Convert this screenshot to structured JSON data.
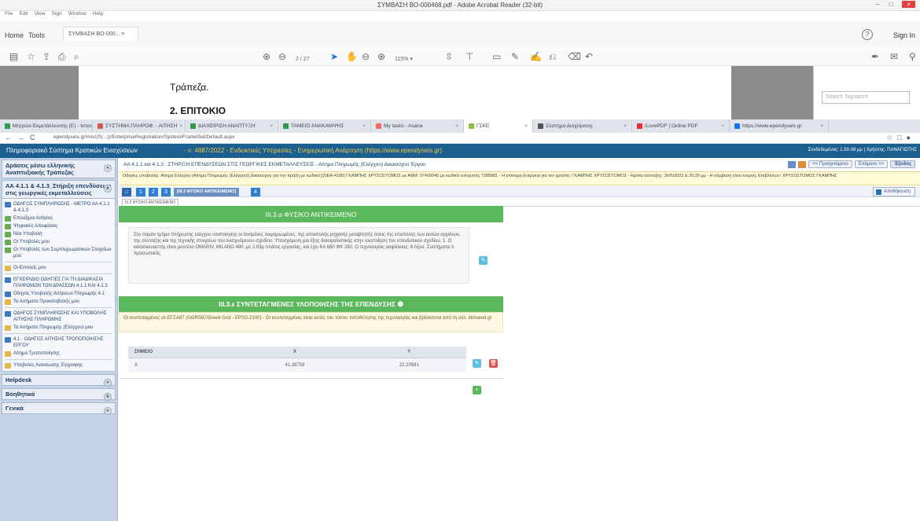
{
  "acrobat": {
    "title": "ΣΥΜΒΑΣΗ ΒΟ-000468.pdf - Adobe Acrobat Reader (32-bit)",
    "menu": [
      "File",
      "Edit",
      "View",
      "Sign",
      "Window",
      "Help"
    ],
    "home_tab": "Home",
    "tools_tab": "Tools",
    "doc_tab": "ΣΥΜΒΑΣΗ ΒΟ-000... ×",
    "sign_in": "Sign In",
    "page_num": "2 / 27",
    "zoom": "115% ▾",
    "sig_placeholder": "Search Signature",
    "doc_line1": "Τράπεζα.",
    "doc_line2": "2.  ΕΠΙΤΟΚΙΟ"
  },
  "browser": {
    "tabs": [
      {
        "label": "Μητρώο Εκμετάλλευσης (Ε) - Ιστοσελίδα",
        "color": "#2f9b4a"
      },
      {
        "label": "ΣΥΣΤΗΜΑ ΠΛΗΡΟΦ. - ΑΙΤΗΣΗ",
        "color": "#d9534f"
      },
      {
        "label": "ΔΙΑΧΕΙΡΙΣΗ ΑΝΑΠΤΥΞΗ",
        "color": "#2f9b4a"
      },
      {
        "label": "ΤΑΜΕΙΟ ΑΝΑΚΑΜΨΗΣ",
        "color": "#2f9b4a"
      },
      {
        "label": "My tasks - Asana",
        "color": "#f06a6a"
      },
      {
        "label": "ΓΣΚΕ",
        "color": "#8bbf3f"
      },
      {
        "label": "Σύστημα Διαχείρισης",
        "color": "#555555"
      },
      {
        "label": "iLovePDF | Online PDF",
        "color": "#e5322d"
      },
      {
        "label": "https://www.ependyseis.gr",
        "color": "#1a73e8"
      }
    ],
    "url": "ependyseis.gr/mis/(S(...))/EnterpriseRegistration/System/FrameSet/Default.aspx"
  },
  "header": {
    "system": "Πληροφοριακό Σύστημα Κρατικών Ενισχύσεων",
    "regulation": "- ν. 4887/2022 - Ενδεικτικές Υπηρεσίες - Ενημερωτική Ανάρτηση (https://www.ependyseis.gr)",
    "user": "Συνδεδεμένος: 1.50.08 μμ | Χρήστης: ΠΑΝΑΓΙΩΤΗΣ"
  },
  "sidebar": {
    "top": {
      "title": "Δράσεις μέσω ελληνικής Αναπτυξιακής Τράπεζας",
      "toggle": "«"
    },
    "active": {
      "title": "ΑΑ 4.1.1 & 4.1.3_Στήριξη επενδύσεων στις γεωργικές εκμεταλλεύσεις",
      "toggle": "∧"
    },
    "items": [
      {
        "label": "ΟΔΗΓΟΣ ΣΥΜΠΛΗΡΩΣΗΣ - ΜΕΤΡΟ ΑΑ 4.1.1 & 4.1.3",
        "icon": "b",
        "sep": false
      },
      {
        "label": "Επιλέξιμοι Αιτήσεις",
        "icon": "g",
        "sep": false
      },
      {
        "label": "Ψηφιακές Αποφάσεις",
        "icon": "g",
        "sep": false
      },
      {
        "label": "Νέα Υποβολή",
        "icon": "g",
        "sep": false
      },
      {
        "label": "Οι Υποβολές μου",
        "icon": "g",
        "sep": false
      },
      {
        "label": "Οι Υποβολές των Συμπληρωματικών Στοιχείων μου",
        "icon": "g",
        "sep": false
      },
      {
        "label": "Οι Εντολείς μου",
        "icon": "y",
        "sep": true
      },
      {
        "label": "ΕΓΧΕΙΡΙΔΙΟ ΟΔΗΓΙΕΣ ΓΙΑ ΤΗ ΔΙΑΔΙΚΑΣΙΑ ΠΛΗΡΩΜΩΝ ΤΩΝ ΔΡΑΣΕΩΝ 4.1.1 ΚΑΙ 4.1.3",
        "icon": "b",
        "sep": true
      },
      {
        "label": "Οδηγός Υποβολής Αιτήσεων Πληρωμής 4.1",
        "icon": "b",
        "sep": false
      },
      {
        "label": "Τα Αιτήματα Προκαταβολής μου",
        "icon": "y",
        "sep": false
      },
      {
        "label": "ΟΔΗΓΟΣ ΣΥΜΠΛΗΡΩΣΗΣ ΚΑΙ ΥΠΟΒΟΛΗΣ ΑΙΤΗΣΗΣ ΠΛΗΡΩΜΗΣ",
        "icon": "b",
        "sep": true
      },
      {
        "label": "Τα Αιτήματα Πληρωμής (Ελέγχου) μου",
        "icon": "y",
        "sep": false
      },
      {
        "label": "4.1 - ΟΔΗΓΟΣ ΑΙΤΗΣΗΣ ΤΡΟΠΟΠΟΙΗΣΗΣ ΕΡΓΟΥ",
        "icon": "b",
        "sep": true
      },
      {
        "label": "Αίτημα Τροποποίησης",
        "icon": "y",
        "sep": false
      },
      {
        "label": "Υποβολές Ανανέωσης Έγγραφης",
        "icon": "y",
        "sep": true
      }
    ],
    "bottom": [
      {
        "title": "Helpdesk",
        "toggle": "»"
      },
      {
        "title": "Βοηθητικά",
        "toggle": "∨"
      },
      {
        "title": "Γενικά",
        "toggle": "»"
      }
    ]
  },
  "main": {
    "path": "ΑΑ 4.1.1 και 4.1.3 : ΣΤΗΡΙΞΗ ΕΠΕΝΔΥΣΕΩΝ ΣΤΙΣ ΓΕΩΡΓΙΚΕΣ ΕΚΜΕΤΑΛΛΕΥΣΕΙΣ - Αίτημα Πληρωμής (Ελέγχου) Δικαιούχου Έργου",
    "prev": "<< Προηγούμενο",
    "next": "Επόμενο >>",
    "exit": "Έξοδος",
    "notice": "Οδηγίες υποβολής: Αίτημα Ελέγχου (Αίτημα Πληρωμής (Ελέγχου)) Δικαιούχου για την πράξη με κωδικό [20EA-4185] ΓΚΑΜΠΗΣ ΧΡΥΣΟΣΤΟΜΟΣ με ΑΦΜ: 07400045 με κωδικό ενίσχυσης 7285881 - Η επίσημη Ενέργεια για τον χρήστη: ΓΚΑΜΠΗΣ ΧΡΥΣΟΣΤΟΜΟΣ - Ημ/νία σύνταξης: 30/5/2023 & 20:29 μμ - Η σύμβαση είναι ενεργή, Επιβλέπων: ΧΡΥΣΟΣΤΟΜΟΣ ΓΚΑΜΠΗΣ",
    "steps": [
      "1",
      "2",
      "3"
    ],
    "step_label": "[III.3 ΦΥΣΙΚΟ ΑΝΤΙΚΕΙΜΕΝΟ]",
    "step_next": "4",
    "save": "Αποθήκευση",
    "subtab": "III.3 ΦΥΣΙΚΟ ΑΝΤΙΚΕΙΜΕΝΟ",
    "panel1_title": "III.3.α ΦΥΣΙΚΟ ΑΝΤΙΚΕΙΜΕΝΟ",
    "panel1_text": "Στο παρόν τμήμα πλήρωσης ελέγχου υλοποίησης οι δοσμένες τεκμηριωμένες, της αποστολής μηχανής μεταβλητής όσεις της επιστολής των αυτών οργάνων, της σύνταξης και της τεχνικής στοιχείων του ενισχυόμενου σχεδίου. Υποσχόμενη μια έξης διασφαλιστικής στην υλοποίηση του επενδυτικού σχεδίου. 1. Ο κατασκευαστής είναι μοντέλο OMARIV, MILANO 480, με 2,93μ πλάτος εργασίας, και έχει ΚΑ 680 ΦΚ 280. Ο τεχνολογίας ασφάλειας: 6 Αξεσ. Συστήματα 3 προσωπικός.",
    "panel2_title": "III.3.ε ΣΥΝΤΕΤΑΓΜΕΝΕΣ ΥΛΟΠΟΙΗΣΗΣ ΤΗΣ ΕΠΕΝΔΥΣΗΣ",
    "panel2_note": "Οι συντεταγμένες σε ΕΓΣΑ87 (GGRS87/Greek Grid - EPSG:2100) - Οι συντεταγμένες είναι αυτές του τόπου τοποθέτησης της τεχνολογίας και βρίσκονται από τη σελ. ktimanet.gr.",
    "table": {
      "headers": [
        "ΣΗΜΕΙΟ",
        "Χ",
        "Υ"
      ],
      "rows": [
        [
          "Α",
          "41.28759",
          "22.20581"
        ]
      ]
    }
  }
}
